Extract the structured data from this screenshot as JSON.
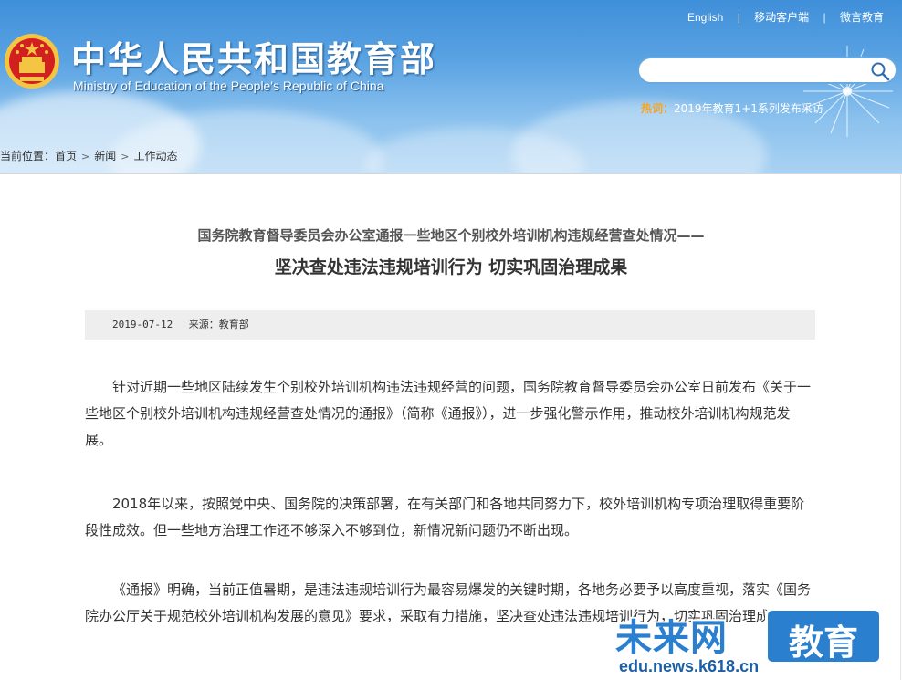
{
  "header": {
    "title_cn": "中华人民共和国教育部",
    "title_en": "Ministry of Education of the People's Republic of China",
    "links": [
      "English",
      "移动客户端",
      "微言教育"
    ],
    "separator": "|",
    "search_placeholder": "",
    "hot_label": "热词：",
    "hot_link": "2019年教育1+1系列发布采访"
  },
  "breadcrumb": {
    "prefix": "当前位置：",
    "items": [
      "首页",
      "新闻",
      "工作动态"
    ]
  },
  "article": {
    "subtitle": "国务院教育督导委员会办公室通报一些地区个别校外培训机构违规经营查处情况——",
    "title": "坚决查处违法违规培训行为 切实巩固治理成果",
    "date": "2019-07-12",
    "source": "来源：教育部",
    "paragraphs": [
      "针对近期一些地区陆续发生个别校外培训机构违法违规经营的问题，国务院教育督导委员会办公室日前发布《关于一些地区个别校外培训机构违规经营查处情况的通报》（简称《通报》），进一步强化警示作用，推动校外培训机构规范发展。",
      "2018年以来，按照党中央、国务院的决策部署，在有关部门和各地共同努力下，校外培训机构专项治理取得重要阶段性成效。但一些地方治理工作还不够深入不够到位，新情况新问题仍不断出现。",
      "《通报》明确，当前正值暑期，是违法违规培训行为最容易爆发的关键时期，各地务必要予以高度重视，落实《国务院办公厅关于规范校外培训机构发展的意见》要求，采取有力措施，坚决查处违法违规培训行为，切实巩固治理成果。"
    ]
  },
  "watermark": {
    "main": "未来网",
    "box": "教育",
    "url": "edu.news.k618.cn"
  },
  "colors": {
    "header_top": "#3f8fd9",
    "hot_label": "#f5a623",
    "watermark_blue": "#2a7fcf"
  }
}
